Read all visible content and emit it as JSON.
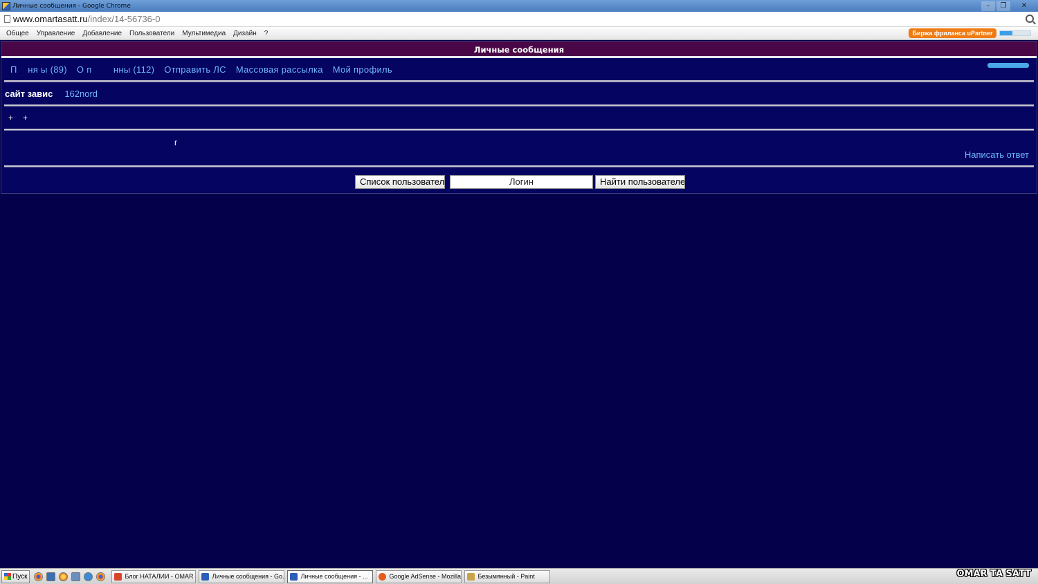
{
  "window": {
    "title": "Личные сообщения - Google Chrome",
    "minimize": "–",
    "restore": "❐",
    "close": "✕"
  },
  "address": {
    "host": "www.omartasatt.ru",
    "path": "/index/14-56736-0"
  },
  "ucoz_panel": {
    "menu": [
      "Общее",
      "Управление",
      "Добавление",
      "Пользователи",
      "Мультимедиа",
      "Дизайн",
      "?"
    ],
    "upartner": "Биржа фриланса uPartner",
    "progress_fraction": 0.4
  },
  "page": {
    "header": "Личные сообщения",
    "nav": {
      "received": "П    ня ы (89)",
      "sent": "О п        нны (112)",
      "send_pm": "Отправить ЛС",
      "mass_mail": "Массовая рассылка",
      "profile": "Мой профиль"
    },
    "info": {
      "label": "сайт завис",
      "user": "162nord"
    },
    "plus_marks": [
      "+",
      "+"
    ],
    "message_glyph": "г",
    "reply": "Написать ответ",
    "search": {
      "list_button": "Список пользователей",
      "login_placeholder": "Логин",
      "find_button": "Найти пользователей"
    }
  },
  "taskbar": {
    "start": "Пуск",
    "quick_icons": [
      "chrome-icon",
      "desktop-icon",
      "firefox-icon",
      "explorer-icon",
      "settings-icon",
      "chrome-icon"
    ],
    "tasks": [
      {
        "label": "Блог НАТАЛИИ - OMAR T...",
        "icon_color": "#d8452b"
      },
      {
        "label": "Личные сообщения - Go...",
        "icon_color": "#2c5fb8"
      },
      {
        "label": "Личные сообщения - ...",
        "icon_color": "#2c5fb8",
        "active": true
      },
      {
        "label": "Google AdSense - Mozilla...",
        "icon_color": "#e35a1c"
      },
      {
        "label": "Безымянный - Paint",
        "icon_color": "#c9a34a"
      }
    ],
    "watermark": "OMAR TA SATT"
  },
  "colors": {
    "background": "#04004a",
    "header": "#4a0747",
    "link": "#6fb4ff"
  }
}
